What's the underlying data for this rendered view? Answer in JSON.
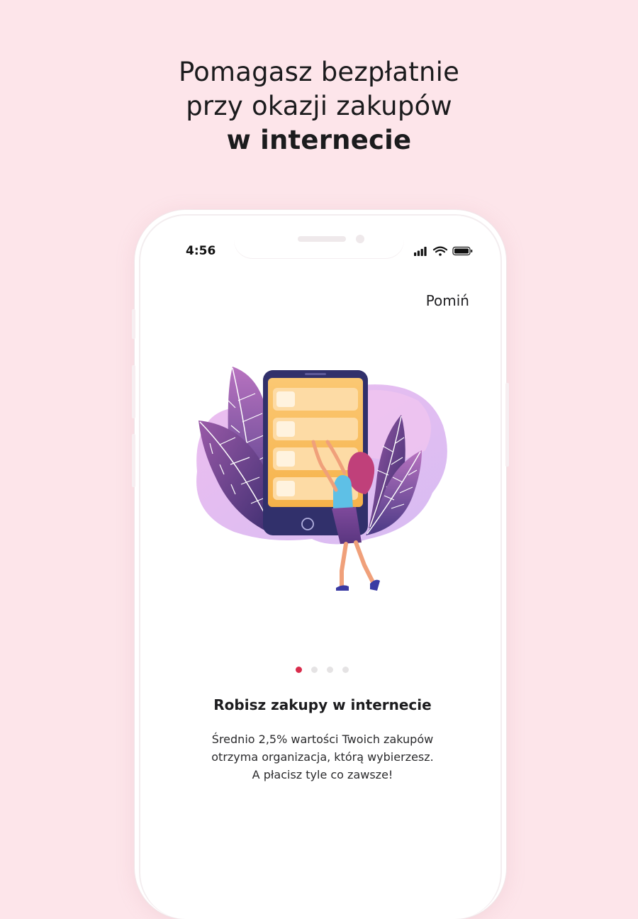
{
  "headline": {
    "line1": "Pomagasz bezpłatnie",
    "line2": "przy okazji zakupów",
    "line3_bold": "w internecie"
  },
  "status_bar": {
    "time": "4:56",
    "icons": [
      "cellular-signal-icon",
      "wifi-icon",
      "battery-icon"
    ]
  },
  "onboarding": {
    "skip_label": "Pomiń",
    "illustration": "woman-touching-phone-list-illustration",
    "pagination": {
      "total": 4,
      "active": 1
    },
    "title": "Robisz zakupy w internecie",
    "body": [
      "Średnio 2,5% wartości Twoich zakupów",
      "otrzyma organizacja, którą wybierzesz.",
      "A płacisz tyle co zawsze!"
    ]
  },
  "colors": {
    "background": "#fde5ea",
    "accent": "#d92c4c",
    "dot_inactive": "#e5e3e4"
  }
}
